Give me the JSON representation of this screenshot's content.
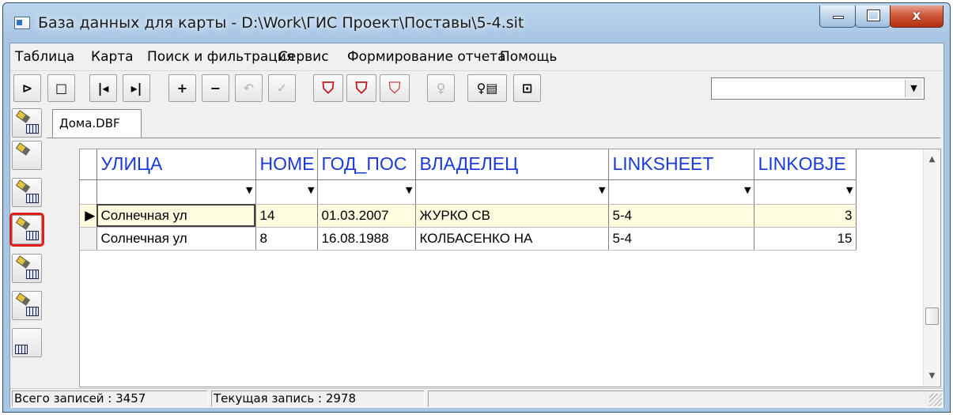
{
  "window": {
    "title": "База данных для карты - D:\\Work\\ГИС Проект\\Поставы\\5-4.sit",
    "close_glyph": "x"
  },
  "menubar": {
    "items": [
      "Таблица",
      "Карта",
      "Поиск и фильтрация",
      "Сервис",
      "Формирование отчета",
      "Помощь"
    ]
  },
  "toolbar": {
    "buttons": [
      {
        "icon": "open-folder-icon",
        "glyph": "⊳"
      },
      {
        "icon": "folder-icon",
        "glyph": "□"
      },
      {
        "icon": "first-record-icon",
        "glyph": "|◂"
      },
      {
        "icon": "last-record-icon",
        "glyph": "▸|"
      },
      {
        "icon": "add-record-icon",
        "glyph": "+"
      },
      {
        "icon": "delete-record-icon",
        "glyph": "−"
      },
      {
        "icon": "undo-icon",
        "glyph": "↶",
        "disabled": true
      },
      {
        "icon": "check-icon",
        "glyph": "✓",
        "disabled": true
      },
      {
        "icon": "filter-icon",
        "glyph": "⛉"
      },
      {
        "icon": "filter-add-icon",
        "glyph": "⛉"
      },
      {
        "icon": "filter-clear-icon",
        "glyph": "⛉",
        "disabled": true
      },
      {
        "icon": "info-icon",
        "glyph": "♀",
        "disabled": true
      },
      {
        "icon": "info-table-icon",
        "glyph": "♀▤"
      },
      {
        "icon": "map-objects-icon",
        "glyph": "⊡"
      }
    ],
    "combo_value": ""
  },
  "sidebar": {
    "buttons": [
      {
        "icon": "add-table-filter-icon"
      },
      {
        "icon": "pencil-arrow-icon"
      },
      {
        "icon": "pencil-table-icon"
      },
      {
        "icon": "pencil-table-highlighted-icon",
        "highlighted": true
      },
      {
        "icon": "delete-table-icon"
      },
      {
        "icon": "delete-records-icon"
      },
      {
        "icon": "table-edit-icon"
      }
    ],
    "highlight_color": "#e0201b"
  },
  "tab": {
    "label": "Дома.DBF"
  },
  "grid": {
    "columns": [
      "УЛИЦА",
      "НОМЕ",
      "ГОД_ПОС",
      "ВЛАДЕЛЕЦ",
      "LINKSHEET",
      "LINKOBJE"
    ],
    "header_color": "#1a3ad8",
    "rows": [
      {
        "current": true,
        "cells": [
          "Солнечная ул",
          "14",
          "01.03.2007",
          "ЖУРКО СВ",
          "5-4",
          "3"
        ]
      },
      {
        "current": false,
        "cells": [
          "Солнечная ул",
          "8",
          "16.08.1988",
          "КОЛБАСЕНКО НА",
          "5-4",
          "15"
        ]
      }
    ]
  },
  "statusbar": {
    "total": "Всего записей : 3457",
    "current": "Текущая запись : 2978"
  }
}
